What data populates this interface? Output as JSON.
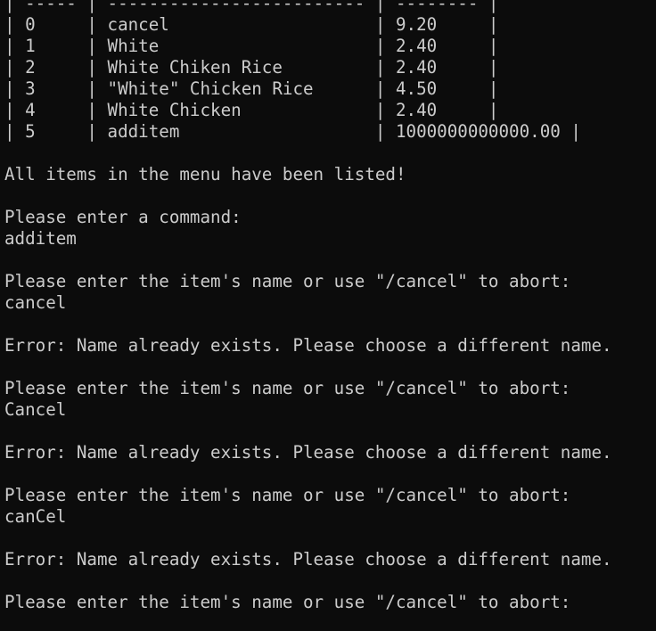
{
  "terminal": {
    "foreground": "#cccccc",
    "background": "#0c0c0c",
    "lines": [
      "| ----- | ------------------------- | -------- |",
      "| 0     | cancel                    | 9.20     |",
      "| 1     | White                     | 2.40     |",
      "| 2     | White Chiken Rice         | 2.40     |",
      "| 3     | \"White\" Chicken Rice      | 4.50     |",
      "| 4     | White Chicken             | 2.40     |",
      "| 5     | additem                   | 1000000000000.00 |",
      "",
      "All items in the menu have been listed!",
      "",
      "Please enter a command:",
      "additem",
      "",
      "Please enter the item's name or use \"/cancel\" to abort:",
      "cancel",
      "",
      "Error: Name already exists. Please choose a different name.",
      "",
      "Please enter the item's name or use \"/cancel\" to abort:",
      "Cancel",
      "",
      "Error: Name already exists. Please choose a different name.",
      "",
      "Please enter the item's name or use \"/cancel\" to abort:",
      "canCel",
      "",
      "Error: Name already exists. Please choose a different name.",
      "",
      "Please enter the item's name or use \"/cancel\" to abort:"
    ]
  }
}
